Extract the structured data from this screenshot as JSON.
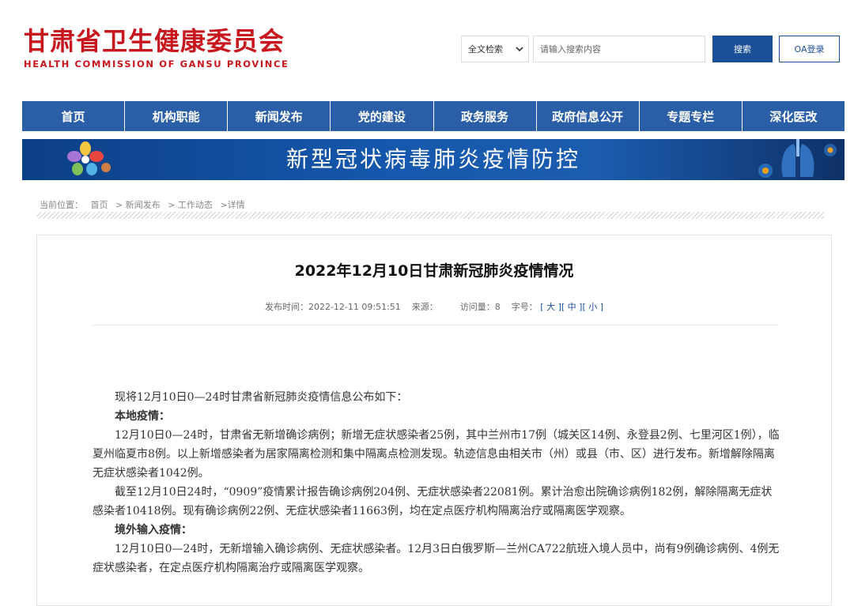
{
  "header": {
    "logo_cn": "甘肃省卫生健康委员会",
    "logo_en": "HEALTH COMMISSION OF GANSU PROVINCE",
    "search_select": "全文检索",
    "search_placeholder": "请输入搜索内容",
    "search_button": "搜索",
    "oa_button": "OA登录",
    "brand_color": "#c8161e",
    "accent_color": "#1a4f97"
  },
  "nav": {
    "items": [
      "首页",
      "机构职能",
      "新闻发布",
      "党的建设",
      "政务服务",
      "政府信息公开",
      "专题专栏",
      "深化医改"
    ]
  },
  "banner": {
    "title": "新型冠状病毒肺炎疫情防控"
  },
  "breadcrumb": {
    "label": "当前位置：",
    "items": [
      "首页",
      "> 新闻发布",
      "> 工作动态",
      ">详情"
    ]
  },
  "article": {
    "title": "2022年12月10日甘肃新冠肺炎疫情情况",
    "meta": {
      "publish_label": "发布时间：",
      "publish_time": "2022-12-11 09:51:51",
      "source_label": "来源：",
      "views_label": "访问量：",
      "views": "8",
      "font_label": "字号：",
      "size_large": "[ 大 ]",
      "size_medium": "[ 中 ]",
      "size_small": "[ 小 ]"
    },
    "paragraphs": [
      "现将12月10日0—24时甘肃省新冠肺炎疫情信息公布如下：",
      "本地疫情：",
      "12月10日0—24时，甘肃省无新增确诊病例；新增无症状感染者25例，其中兰州市17例（城关区14例、永登县2例、七里河区1例），临夏州临夏市8例。以上新增感染者为居家隔离检测和集中隔离点检测发现。轨迹信息由相关市（州）或县（市、区）进行发布。新增解除隔离无症状感染者1042例。",
      "截至12月10日24时，“0909”疫情累计报告确诊病例204例、无症状感染者22081例。累计治愈出院确诊病例182例，解除隔离无症状感染者10418例。现有确诊病例22例、无症状感染者11663例，均在定点医疗机构隔离治疗或隔离医学观察。",
      "境外输入疫情：",
      "12月10日0—24时，无新增输入确诊病例、无症状感染者。12月3日白俄罗斯—兰州CA722航班入境人员中，尚有9例确诊病例、4例无症状感染者，在定点医疗机构隔离治疗或隔离医学观察。"
    ]
  }
}
